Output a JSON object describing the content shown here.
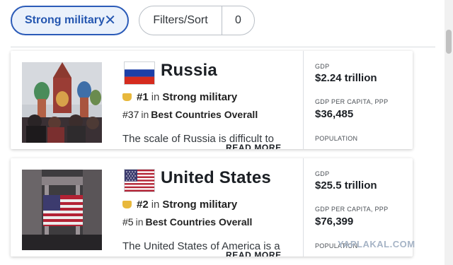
{
  "filters": {
    "active_chip": "Strong military",
    "clear_icon": "close-icon",
    "filter_sort_label": "Filters/Sort",
    "filter_count": "0"
  },
  "cards": [
    {
      "country": "Russia",
      "rank_primary": "#1",
      "rank_primary_in": "in",
      "rank_primary_category": "Strong military",
      "rank_secondary": "#37",
      "rank_secondary_in": "in",
      "rank_secondary_category": "Best Countries Overall",
      "description": "The scale of Russia is difficult to",
      "read_more": "READ MORE",
      "stats": {
        "gdp_label": "GDP",
        "gdp_value": "$2.24 trillion",
        "gdp_pc_label": "GDP PER CAPITA, PPP",
        "gdp_pc_value": "$36,485",
        "population_label": "POPULATION"
      },
      "flag_colors": [
        "#ffffff",
        "#1c3fa8",
        "#d52b1e"
      ]
    },
    {
      "country": "United States",
      "rank_primary": "#2",
      "rank_primary_in": "in",
      "rank_primary_category": "Strong military",
      "rank_secondary": "#5",
      "rank_secondary_in": "in",
      "rank_secondary_category": "Best Countries Overall",
      "description": "The United States of America is a",
      "read_more": "READ MORE",
      "stats": {
        "gdp_label": "GDP",
        "gdp_value": "$25.5 trillion",
        "gdp_pc_label": "GDP PER CAPITA, PPP",
        "gdp_pc_value": "$76,399",
        "population_label": "POPULATION"
      },
      "flag_colors": [
        "#b22234",
        "#ffffff",
        "#3c3b6e"
      ]
    }
  ],
  "watermark": "YAPLAKAL.COM",
  "colors": {
    "accent": "#2456b0",
    "badge": "#e8b83c"
  }
}
